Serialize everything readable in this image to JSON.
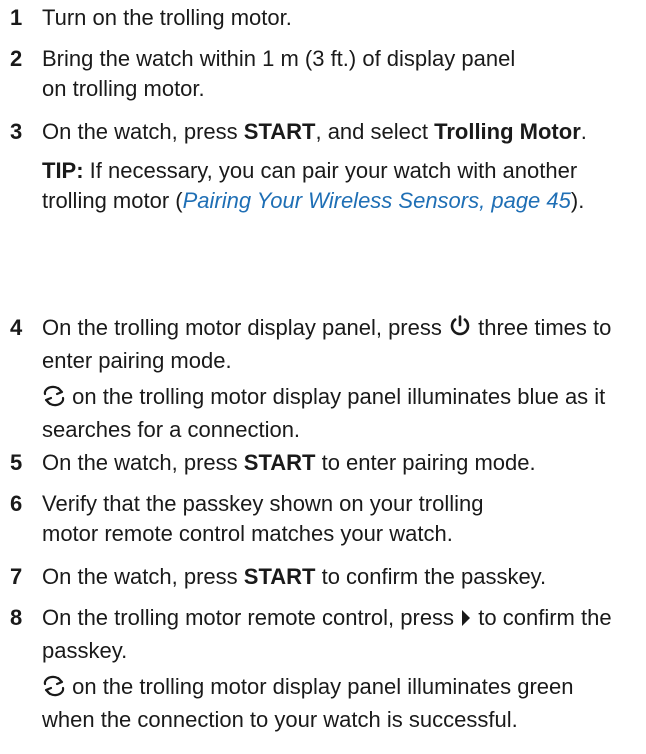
{
  "steps": [
    {
      "number": "1",
      "text": "Turn on the trolling motor."
    },
    {
      "number": "2",
      "line1": "Bring the watch within 1 m (3 ft.) of display panel",
      "line2": "on trolling motor."
    },
    {
      "number": "3",
      "pre": "On the watch, press ",
      "key": "START",
      "mid": ", and select ",
      "option": "Trolling Motor",
      "end": ".",
      "tip_label": "TIP:",
      "tip_text": " If necessary, you can pair your watch with another trolling motor (",
      "tip_link": "Pairing Your Wireless Sensors, page 45",
      "tip_end": ")."
    },
    {
      "number": "4",
      "pre": "On the trolling motor display panel, press ",
      "post": " three times to enter pairing mode.",
      "icon": "power-icon",
      "note_icon": "pairing-arrows-icon",
      "note_text": " on the trolling motor display panel illuminates blue as it searches for a connection."
    },
    {
      "number": "5",
      "pre": "On the watch, press ",
      "key": "START",
      "post": " to enter pairing mode."
    },
    {
      "number": "6",
      "line1": "Verify that the passkey shown on your trolling",
      "line2": "motor remote control matches your watch."
    },
    {
      "number": "7",
      "pre": "On the watch, press ",
      "key": "START",
      "post": " to confirm the passkey."
    },
    {
      "number": "8",
      "pre": "On the trolling motor remote control, press ",
      "post": " to confirm the passkey.",
      "icon": "play-arrow-icon",
      "note_icon": "pairing-arrows-icon",
      "note_text": " on the trolling motor display panel illuminates green when the connection to your watch is successful."
    }
  ]
}
